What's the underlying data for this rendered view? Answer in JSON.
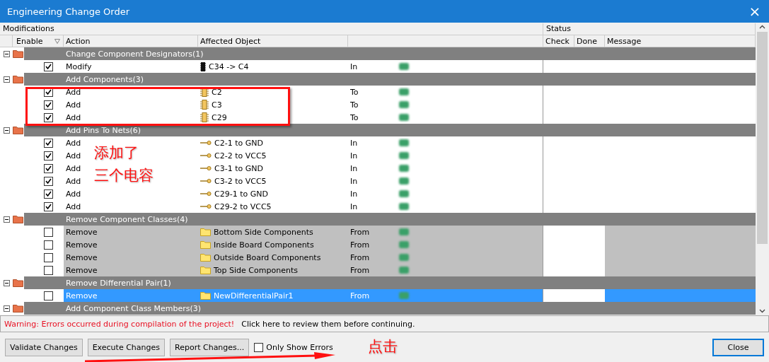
{
  "window": {
    "title": "Engineering Change Order",
    "close": "×"
  },
  "header": {
    "modifications": "Modifications",
    "status": "Status"
  },
  "columns": {
    "enable": "Enable",
    "action": "Action",
    "object": "Affected Object",
    "check": "Check",
    "done": "Done",
    "message": "Message"
  },
  "groups": [
    {
      "title": "Change Component Designators(1)",
      "expanded": true,
      "items": [
        {
          "enabled": true,
          "selected": false,
          "action": "Modify",
          "kind": "chip",
          "object": "C34 -> C4",
          "relation": "In"
        }
      ]
    },
    {
      "title": "Add Components(3)",
      "expanded": true,
      "items": [
        {
          "enabled": true,
          "selected": false,
          "action": "Add",
          "kind": "component",
          "object": "C2",
          "relation": "To"
        },
        {
          "enabled": true,
          "selected": false,
          "action": "Add",
          "kind": "component",
          "object": "C3",
          "relation": "To"
        },
        {
          "enabled": true,
          "selected": false,
          "action": "Add",
          "kind": "component",
          "object": "C29",
          "relation": "To"
        }
      ]
    },
    {
      "title": "Add Pins To Nets(6)",
      "expanded": true,
      "items": [
        {
          "enabled": true,
          "selected": false,
          "action": "Add",
          "kind": "pin",
          "object": "C2-1 to GND",
          "relation": "In"
        },
        {
          "enabled": true,
          "selected": false,
          "action": "Add",
          "kind": "pin",
          "object": "C2-2 to VCC5",
          "relation": "In"
        },
        {
          "enabled": true,
          "selected": false,
          "action": "Add",
          "kind": "pin",
          "object": "C3-1 to GND",
          "relation": "In"
        },
        {
          "enabled": true,
          "selected": false,
          "action": "Add",
          "kind": "pin",
          "object": "C3-2 to VCC5",
          "relation": "In"
        },
        {
          "enabled": true,
          "selected": false,
          "action": "Add",
          "kind": "pin",
          "object": "C29-1 to GND",
          "relation": "In"
        },
        {
          "enabled": true,
          "selected": false,
          "action": "Add",
          "kind": "pin",
          "object": "C29-2 to VCC5",
          "relation": "In"
        }
      ]
    },
    {
      "title": "Remove Component Classes(4)",
      "expanded": true,
      "items": [
        {
          "enabled": false,
          "selected": false,
          "action": "Remove",
          "kind": "folder",
          "object": "Bottom Side Components",
          "relation": "From"
        },
        {
          "enabled": false,
          "selected": false,
          "action": "Remove",
          "kind": "folder",
          "object": "Inside Board Components",
          "relation": "From"
        },
        {
          "enabled": false,
          "selected": false,
          "action": "Remove",
          "kind": "folder",
          "object": "Outside Board Components",
          "relation": "From"
        },
        {
          "enabled": false,
          "selected": false,
          "action": "Remove",
          "kind": "folder",
          "object": "Top Side Components",
          "relation": "From"
        }
      ]
    },
    {
      "title": "Remove Differential Pair(1)",
      "expanded": true,
      "items": [
        {
          "enabled": false,
          "selected": true,
          "action": "Remove",
          "kind": "folder",
          "object": "NewDifferentialPair1",
          "relation": "From"
        }
      ]
    },
    {
      "title": "Add Component Class Members(3)",
      "expanded": true
    }
  ],
  "warning": {
    "error": "Warning: Errors occurred during compilation of the project!",
    "hint": "Click here to review them before continuing."
  },
  "buttons": [
    {
      "label": "Validate Changes"
    },
    {
      "label": "Execute Changes"
    },
    {
      "label": "Report Changes..."
    }
  ],
  "only_show_errors": {
    "label": "Only Show Errors",
    "checked": false
  },
  "close_button": "Close",
  "annotations": {
    "note": [
      "添加了",
      "三个电容"
    ],
    "click": "点击"
  }
}
